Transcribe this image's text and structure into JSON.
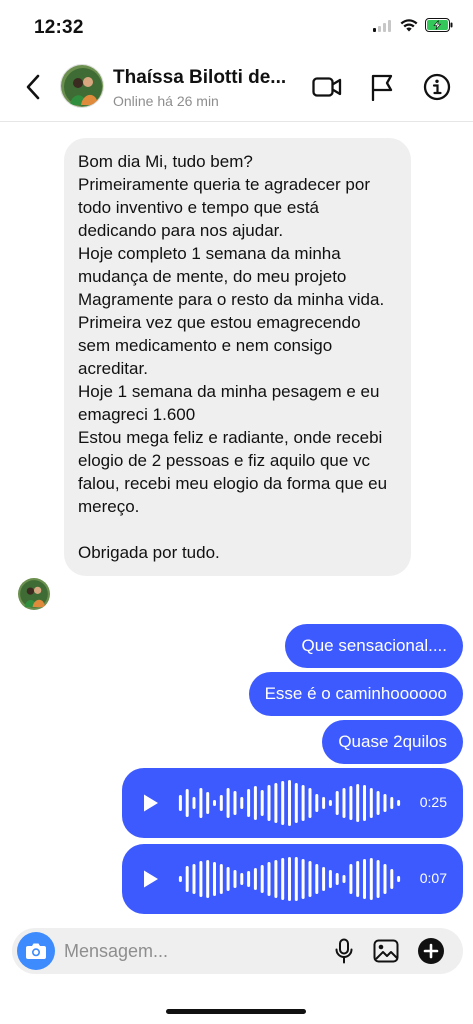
{
  "status": {
    "time": "12:32",
    "icons": [
      "signal-icon",
      "wifi-icon",
      "battery-charging-icon"
    ]
  },
  "header": {
    "name": "Thaíssa Bilotti de...",
    "subtitle": "Online há 26 min",
    "icons": [
      "back-chevron-icon",
      "video-call-icon",
      "report-flag-icon",
      "info-icon"
    ]
  },
  "incoming": {
    "lines": [
      "Bom dia Mi, tudo bem?",
      "Primeiramente queria te agradecer por todo inventivo e tempo que está dedicando para nos ajudar.",
      "Hoje completo 1 semana da minha mudança de mente, do meu projeto Magramente para o resto da minha vida.",
      "Primeira vez que estou emagrecendo sem medicamento e nem consigo acreditar.",
      "Hoje 1 semana da minha pesagem e eu emagreci 1.600",
      "Estou mega feliz e radiante, onde recebi elogio de 2 pessoas e fiz aquilo que vc falou, recebi meu elogio da forma que eu mereço.",
      "Obrigada por tudo."
    ]
  },
  "outgoing": [
    "Que sensacional....",
    "Esse é o caminhoooooo",
    "Quase 2quilos"
  ],
  "voice_messages": [
    {
      "duration": "0:25"
    },
    {
      "duration": "0:07"
    }
  ],
  "composer": {
    "placeholder": "Mensagem..."
  },
  "colors": {
    "accent": "#3d5afe",
    "incoming_bg": "#efefef",
    "camera": "#3d8bfd"
  }
}
